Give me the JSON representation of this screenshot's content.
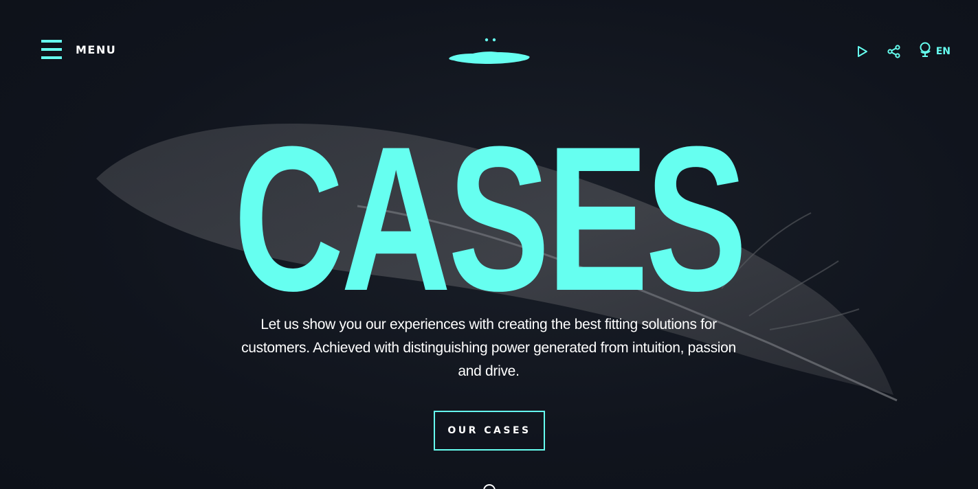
{
  "header": {
    "menu_label": "MENU",
    "logo_name": "ink-blob-logo",
    "play_icon": "play-icon",
    "share_icon": "share-icon",
    "globe_icon": "globe-icon",
    "language": "EN"
  },
  "hero": {
    "title": "CASES",
    "description": "Let us show you our experiences with creating the best fitting solutions for customers. Achieved with distinguishing power generated from intuition, passion and drive.",
    "cta_label": "OUR CASES",
    "background_image": "feather"
  },
  "colors": {
    "accent": "#66fff0",
    "background": "#10141d",
    "text": "#ffffff"
  }
}
